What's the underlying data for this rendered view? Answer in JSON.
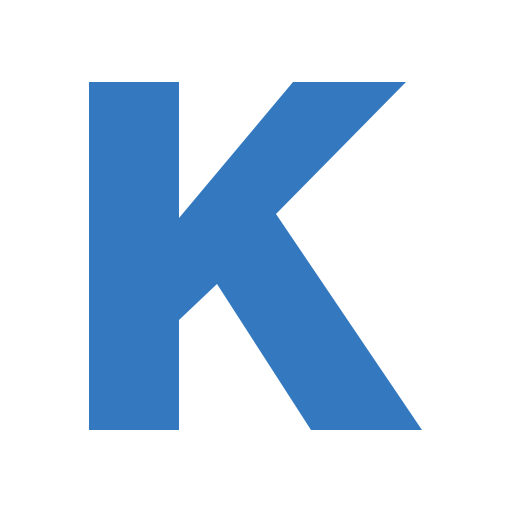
{
  "logo": {
    "icon": "letter-k-logo-icon",
    "letter": "K",
    "color": "#3479C0",
    "background": "#FFFFFF"
  }
}
